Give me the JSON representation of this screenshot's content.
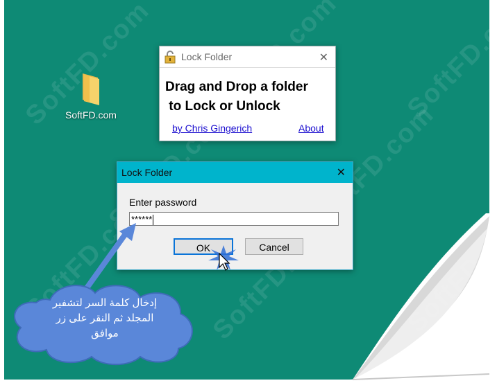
{
  "desktop": {
    "background_color": "#0e8a75",
    "watermark": "SoftFD.com",
    "icon": {
      "name": "folder-icon",
      "label": "SoftFD.com"
    }
  },
  "lock_window": {
    "title": "Lock Folder",
    "message": "Drag and Drop a folder\n to Lock or Unlock",
    "author_link": "by Chris Gingerich",
    "about_link": "About"
  },
  "password_dialog": {
    "title": "Lock Folder",
    "prompt": "Enter password",
    "password_value": "******",
    "ok_label": "OK",
    "cancel_label": "Cancel",
    "title_bar_color": "#00b4cc"
  },
  "callout": {
    "text_line1": "إدخال كلمة السر لتشفير",
    "text_line2": "المجلد ثم النقر على زر",
    "text_line3": "موافق",
    "color": "#5a87d9"
  }
}
